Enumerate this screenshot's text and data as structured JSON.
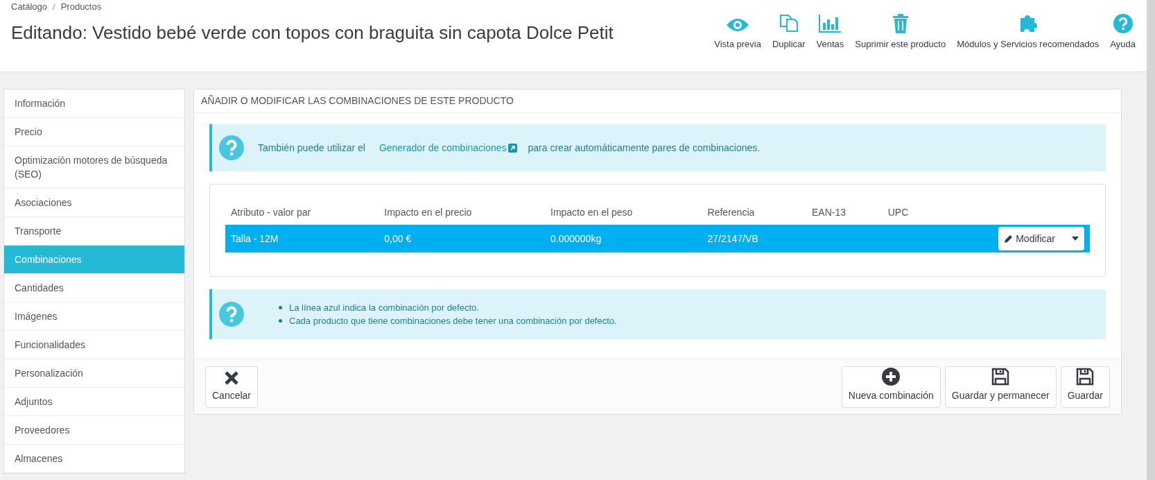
{
  "breadcrumb": {
    "separator": "/",
    "items": [
      "Catálogo",
      "Productos"
    ]
  },
  "page_title": "Editando: Vestido bebé verde con topos con braguita sin capota Dolce Petit",
  "toolbar": [
    {
      "kind": "eye",
      "label": "Vista previa"
    },
    {
      "kind": "copy",
      "label": "Duplicar"
    },
    {
      "kind": "chart",
      "label": "Ventas"
    },
    {
      "kind": "trash",
      "label": "Suprimir este producto"
    },
    {
      "kind": "puzzle",
      "label": "Módulos y Servicios recomendados"
    },
    {
      "kind": "help",
      "label": "Ayuda"
    }
  ],
  "sidebar": {
    "items": [
      {
        "label": "Información",
        "selected": false
      },
      {
        "label": "Precio",
        "selected": false
      },
      {
        "label": "Optimización motores de búsqueda (SEO)",
        "selected": false
      },
      {
        "label": "Asociaciones",
        "selected": false
      },
      {
        "label": "Transporte",
        "selected": false
      },
      {
        "label": "Combinaciones",
        "selected": true
      },
      {
        "label": "Cantidades",
        "selected": false
      },
      {
        "label": "Imágenes",
        "selected": false
      },
      {
        "label": "Funcionalidades",
        "selected": false
      },
      {
        "label": "Personalización",
        "selected": false
      },
      {
        "label": "Adjuntos",
        "selected": false
      },
      {
        "label": "Proveedores",
        "selected": false
      },
      {
        "label": "Almacenes",
        "selected": false
      }
    ]
  },
  "panel": {
    "heading": "AÑADIR O MODIFICAR LAS COMBINACIONES DE ESTE PRODUCTO",
    "info": {
      "before": "También puede utilizar el",
      "link": "Generador de combinaciones",
      "after": "para crear automáticamente pares de combinaciones."
    },
    "table": {
      "columns": [
        "Atributo - valor par",
        "Impacto en el precio",
        "Impacto en el peso",
        "Referencia",
        "EAN-13",
        "UPC"
      ],
      "rows": [
        {
          "cells": [
            "Talla - 12M",
            "0,00 €",
            "0.000000kg",
            "27/2147/VB",
            "",
            ""
          ],
          "selected": true,
          "action": "Modificar"
        }
      ]
    },
    "notes": [
      "La línea azul indica la combinación por defecto.",
      "Cada producto que tiene combinaciones debe tener una combinación por defecto."
    ],
    "footer": [
      {
        "kind": "cancel",
        "label": "Cancelar"
      },
      {
        "kind": "plus",
        "label": "Nueva combinación"
      },
      {
        "kind": "save",
        "label": "Guardar y permanecer"
      },
      {
        "kind": "save",
        "label": "Guardar"
      }
    ]
  }
}
